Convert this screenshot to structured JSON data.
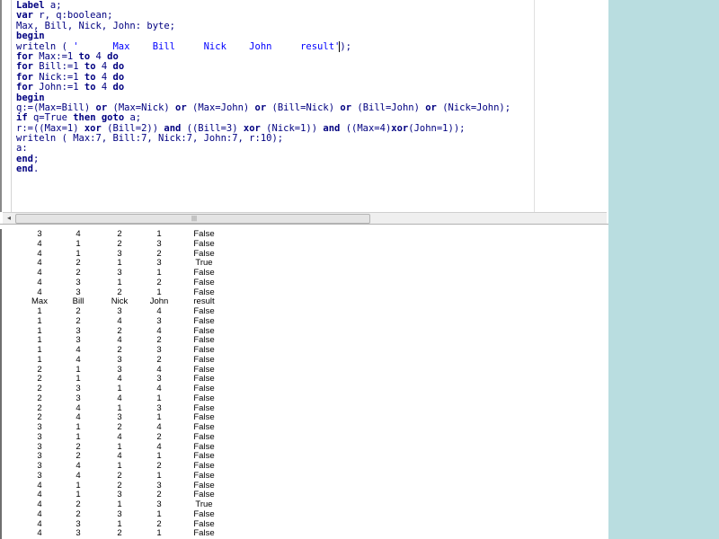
{
  "editor": {
    "code_lines": [
      [
        {
          "t": "Label",
          "c": "kw"
        },
        {
          "t": " a;",
          "c": "id"
        }
      ],
      [
        {
          "t": "var",
          "c": "kw"
        },
        {
          "t": " r, q:boolean;",
          "c": "id"
        }
      ],
      [
        {
          "t": "Max, Bill, Nick, John: byte;",
          "c": "id"
        }
      ],
      [
        {
          "t": "begin",
          "c": "kw"
        }
      ],
      [
        {
          "t": "writeln ( ",
          "c": "id"
        },
        {
          "t": "'      Max    Bill     Nick    John     result'",
          "c": "str"
        },
        {
          "t": ");",
          "c": "id"
        }
      ],
      [
        {
          "t": "for",
          "c": "kw"
        },
        {
          "t": " Max:=1 ",
          "c": "id"
        },
        {
          "t": "to",
          "c": "kw"
        },
        {
          "t": " 4 ",
          "c": "id"
        },
        {
          "t": "do",
          "c": "kw"
        }
      ],
      [
        {
          "t": "for",
          "c": "kw"
        },
        {
          "t": " Bill:=1 ",
          "c": "id"
        },
        {
          "t": "to",
          "c": "kw"
        },
        {
          "t": " 4 ",
          "c": "id"
        },
        {
          "t": "do",
          "c": "kw"
        }
      ],
      [
        {
          "t": "for",
          "c": "kw"
        },
        {
          "t": " Nick:=1 ",
          "c": "id"
        },
        {
          "t": "to",
          "c": "kw"
        },
        {
          "t": " 4 ",
          "c": "id"
        },
        {
          "t": "do",
          "c": "kw"
        }
      ],
      [
        {
          "t": "for",
          "c": "kw"
        },
        {
          "t": " John:=1 ",
          "c": "id"
        },
        {
          "t": "to",
          "c": "kw"
        },
        {
          "t": " 4 ",
          "c": "id"
        },
        {
          "t": "do",
          "c": "kw"
        }
      ],
      [
        {
          "t": "begin",
          "c": "kw"
        }
      ],
      [
        {
          "t": "q:=(Max=Bill) ",
          "c": "id"
        },
        {
          "t": "or",
          "c": "kw"
        },
        {
          "t": " (Max=Nick) ",
          "c": "id"
        },
        {
          "t": "or",
          "c": "kw"
        },
        {
          "t": " (Max=John) ",
          "c": "id"
        },
        {
          "t": "or",
          "c": "kw"
        },
        {
          "t": " (Bill=Nick) ",
          "c": "id"
        },
        {
          "t": "or",
          "c": "kw"
        },
        {
          "t": " (Bill=John) ",
          "c": "id"
        },
        {
          "t": "or",
          "c": "kw"
        },
        {
          "t": " (Nick=John);",
          "c": "id"
        }
      ],
      [
        {
          "t": "if",
          "c": "kw"
        },
        {
          "t": " q=True ",
          "c": "id"
        },
        {
          "t": "then",
          "c": "kw"
        },
        {
          "t": " ",
          "c": "id"
        },
        {
          "t": "goto",
          "c": "kw"
        },
        {
          "t": " a;",
          "c": "id"
        }
      ],
      [
        {
          "t": "r:=((Max=1) ",
          "c": "id"
        },
        {
          "t": "xor",
          "c": "kw"
        },
        {
          "t": " (Bill=2)) ",
          "c": "id"
        },
        {
          "t": "and",
          "c": "kw"
        },
        {
          "t": " ((Bill=3) ",
          "c": "id"
        },
        {
          "t": "xor",
          "c": "kw"
        },
        {
          "t": " (Nick=1)) ",
          "c": "id"
        },
        {
          "t": "and",
          "c": "kw"
        },
        {
          "t": " ((Max=4)",
          "c": "id"
        },
        {
          "t": "xor",
          "c": "kw"
        },
        {
          "t": "(John=1));",
          "c": "id"
        }
      ],
      [
        {
          "t": "writeln ( Max:7, Bill:7, Nick:7, John:7, r:10);",
          "c": "id"
        }
      ],
      [
        {
          "t": "a:",
          "c": "id"
        }
      ],
      [
        {
          "t": "end",
          "c": "kw"
        },
        {
          "t": ";",
          "c": "id"
        }
      ],
      [
        {
          "t": "end",
          "c": "kw"
        },
        {
          "t": ".",
          "c": "id"
        }
      ]
    ]
  },
  "scrollbar": {
    "left_arrow": "◂",
    "grip": "|||"
  },
  "output": {
    "rows": [
      [
        "3",
        "4",
        "2",
        "1",
        "False"
      ],
      [
        "4",
        "1",
        "2",
        "3",
        "False"
      ],
      [
        "4",
        "1",
        "3",
        "2",
        "False"
      ],
      [
        "4",
        "2",
        "1",
        "3",
        "True"
      ],
      [
        "4",
        "2",
        "3",
        "1",
        "False"
      ],
      [
        "4",
        "3",
        "1",
        "2",
        "False"
      ],
      [
        "4",
        "3",
        "2",
        "1",
        "False"
      ],
      [
        "Max",
        "Bill",
        "Nick",
        "John",
        "result"
      ],
      [
        "1",
        "2",
        "3",
        "4",
        "False"
      ],
      [
        "1",
        "2",
        "4",
        "3",
        "False"
      ],
      [
        "1",
        "3",
        "2",
        "4",
        "False"
      ],
      [
        "1",
        "3",
        "4",
        "2",
        "False"
      ],
      [
        "1",
        "4",
        "2",
        "3",
        "False"
      ],
      [
        "1",
        "4",
        "3",
        "2",
        "False"
      ],
      [
        "2",
        "1",
        "3",
        "4",
        "False"
      ],
      [
        "2",
        "1",
        "4",
        "3",
        "False"
      ],
      [
        "2",
        "3",
        "1",
        "4",
        "False"
      ],
      [
        "2",
        "3",
        "4",
        "1",
        "False"
      ],
      [
        "2",
        "4",
        "1",
        "3",
        "False"
      ],
      [
        "2",
        "4",
        "3",
        "1",
        "False"
      ],
      [
        "3",
        "1",
        "2",
        "4",
        "False"
      ],
      [
        "3",
        "1",
        "4",
        "2",
        "False"
      ],
      [
        "3",
        "2",
        "1",
        "4",
        "False"
      ],
      [
        "3",
        "2",
        "4",
        "1",
        "False"
      ],
      [
        "3",
        "4",
        "1",
        "2",
        "False"
      ],
      [
        "3",
        "4",
        "2",
        "1",
        "False"
      ],
      [
        "4",
        "1",
        "2",
        "3",
        "False"
      ],
      [
        "4",
        "1",
        "3",
        "2",
        "False"
      ],
      [
        "4",
        "2",
        "1",
        "3",
        "True"
      ],
      [
        "4",
        "2",
        "3",
        "1",
        "False"
      ],
      [
        "4",
        "3",
        "1",
        "2",
        "False"
      ],
      [
        "4",
        "3",
        "2",
        "1",
        "False"
      ]
    ]
  }
}
